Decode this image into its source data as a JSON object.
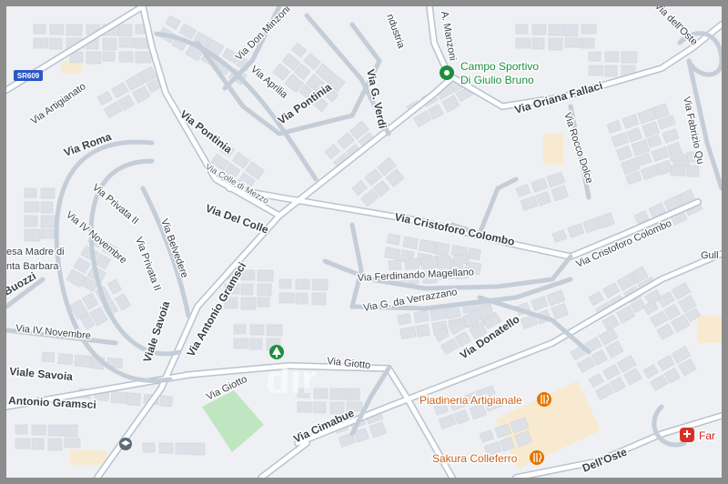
{
  "map": {
    "watermark": "dir",
    "colors": {
      "background": "#eef0f3",
      "road": "#ffffff",
      "road_casing": "#b8c3d0",
      "building": "#dde1e7",
      "park": "#bfe6c0",
      "sand": "#f7ead0",
      "border": "#8d8d8d"
    },
    "shield": {
      "label": "SR609"
    },
    "streets": {
      "industria": "ndustria",
      "manzoni": "A. Manzoni",
      "oste_top": "Via dell'Oste",
      "don_minzoni": "Via Don Minzoni",
      "aprilia": "Via Aprilia",
      "pontinia_upper": "Via Pontinia",
      "g_verdi": "Via G. Verdi",
      "artigianato": "Via Artigianato",
      "oriana_fallaci": "Via Oriana Fallaci",
      "fabrizio": "Via Fabrizio Qu",
      "rocco_dolce": "Via Rocco Dolce",
      "roma": "Via Roma",
      "pontinia_main": "Via Pontinia",
      "colle_di_mezzo": "Via Colle di Mezzo",
      "del_colle": "Via Del Colle",
      "privata_1": "Via Privata II",
      "iv_novembre_inner": "Via IV Novembre",
      "belvedere": "Via Belvedere",
      "privata_2": "Via Privata II",
      "colombo_1": "Via Cristoforo Colombo",
      "colombo_2": "Via Cristoforo Colombo",
      "magellano": "Via Ferdinando Magellano",
      "verrazzano": "Via G. da Verrazzano",
      "donatello": "Via Donatello",
      "savoia_inner": "Viale Savoia",
      "gramsci_diag": "Via Antonio Gramsci",
      "iv_novembre_left": "Via IV Novembre",
      "savoia_left": "Viale Savoia",
      "gramsci_left": "Antonio Gramsci",
      "buozzi": "Buozzi",
      "giotto_1": "Via Giotto",
      "giotto_2": "Via Giotto",
      "cimabue": "Via Cimabue",
      "oste_bottom": "Dell'Oste",
      "gull": "Gull"
    },
    "pois": {
      "campo_line1": "Campo Sportivo",
      "campo_line2": "Di Giulio Bruno",
      "chiesa_line1": "esa Madre di",
      "chiesa_line2": "nta Barbara",
      "piadineria": "Piadineria Artigianale",
      "sakura": "Sakura Colleferro",
      "farmacia": "Far"
    },
    "icons": {
      "campo": "map-pin-icon",
      "park": "tree-icon",
      "piadineria": "food-icon",
      "sakura": "food-icon",
      "farmacia": "pharmacy-icon",
      "school": "school-icon"
    }
  }
}
